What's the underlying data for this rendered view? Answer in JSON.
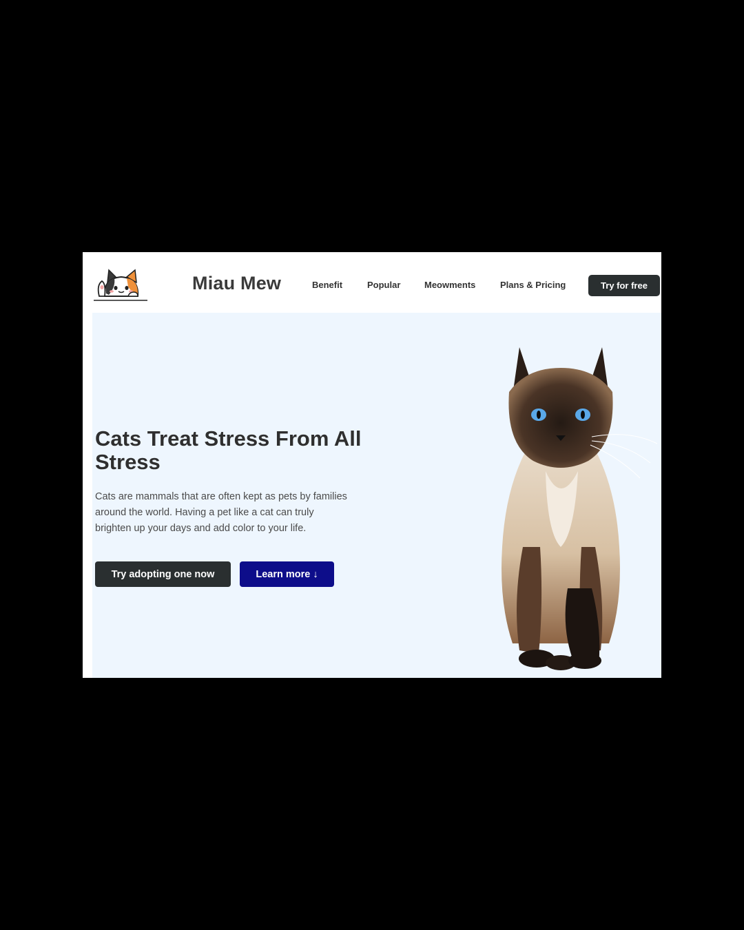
{
  "brand": {
    "name": "Miau Mew",
    "logo_icon": "cat-mascot-icon"
  },
  "nav": {
    "links": [
      "Benefit",
      "Popular",
      "Meowments",
      "Plans & Pricing"
    ],
    "cta_label": "Try for free"
  },
  "hero": {
    "title": "Cats Treat Stress From All Stress",
    "description": "Cats are mammals that are often kept as pets by families around the world. Having a pet like a cat can truly brighten up your days and add color to your life.",
    "primary_button": "Try adopting one now",
    "secondary_button": "Learn more ↓",
    "image_icon": "siamese-cat-photo"
  },
  "colors": {
    "page_background": "#000000",
    "hero_background": "#eef6fe",
    "dark_button": "#2a2f30",
    "accent_button": "#0d0d8a"
  }
}
